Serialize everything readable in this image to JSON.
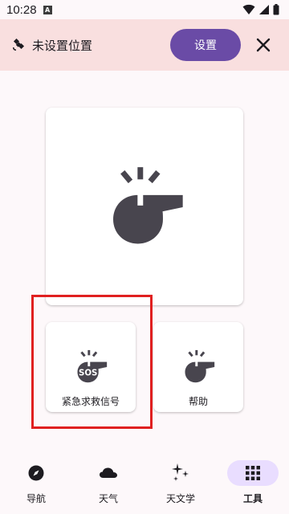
{
  "status_bar": {
    "time": "10:28",
    "notification_badge": "A"
  },
  "banner": {
    "text": "未设置位置",
    "button_label": "设置",
    "icon": "satellite-icon",
    "close_icon": "close-icon",
    "background": "#f9dfdf",
    "button_color": "#6a4ba6"
  },
  "main_tool": {
    "icon": "whistle-icon"
  },
  "tools": [
    {
      "label": "紧急求救信号",
      "icon": "sos-whistle-icon",
      "badge": "SOS"
    },
    {
      "label": "帮助",
      "icon": "whistle-icon"
    }
  ],
  "bottom_nav": {
    "items": [
      {
        "label": "导航",
        "icon": "compass-icon"
      },
      {
        "label": "天气",
        "icon": "cloud-icon"
      },
      {
        "label": "天文学",
        "icon": "sparkles-icon"
      },
      {
        "label": "工具",
        "icon": "grid-icon",
        "active": true
      }
    ],
    "active_color": "#e9ddff"
  },
  "highlight_color": "#e02020"
}
